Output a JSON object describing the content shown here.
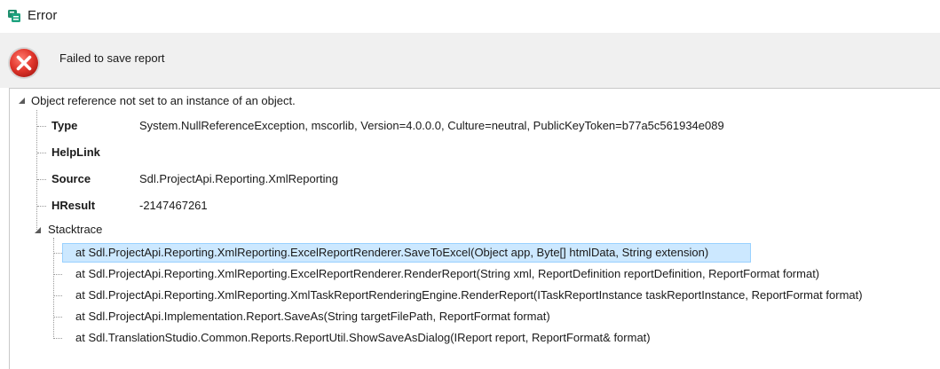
{
  "window": {
    "title": "Error"
  },
  "header": {
    "message": "Failed to save report"
  },
  "tree": {
    "root_label": "Object reference not set to an instance of an object.",
    "properties": [
      {
        "name": "Type",
        "value": "System.NullReferenceException, mscorlib, Version=4.0.0.0, Culture=neutral, PublicKeyToken=b77a5c561934e089"
      },
      {
        "name": "HelpLink",
        "value": ""
      },
      {
        "name": "Source",
        "value": "Sdl.ProjectApi.Reporting.XmlReporting"
      },
      {
        "name": "HResult",
        "value": "-2147467261"
      }
    ],
    "stacktrace_label": "Stacktrace",
    "stacktrace": [
      "at Sdl.ProjectApi.Reporting.XmlReporting.ExcelReportRenderer.SaveToExcel(Object app, Byte[]  htmlData, String extension)",
      "at Sdl.ProjectApi.Reporting.XmlReporting.ExcelReportRenderer.RenderReport(String xml, ReportDefinition  reportDefinition, ReportFormat format)",
      "at Sdl.ProjectApi.Reporting.XmlReporting.XmlTaskReportRenderingEngine.RenderReport(ITaskReportInstance  taskReportInstance, ReportFormat format)",
      "at Sdl.ProjectApi.Implementation.Report.SaveAs(String targetFilePath, ReportFormat format)",
      "at Sdl.TranslationStudio.Common.Reports.ReportUtil.ShowSaveAsDialog(IReport report, ReportFormat& format)"
    ],
    "selected_index": 0
  },
  "colors": {
    "header_band": "#f0f0f0",
    "selection_fill": "#cce8ff",
    "selection_border": "#99d1ff",
    "error_red": "#d9322c"
  },
  "icons": {
    "app": "app-logo-icon",
    "error": "error-x-icon",
    "expander": "triangle-expanded-icon"
  }
}
